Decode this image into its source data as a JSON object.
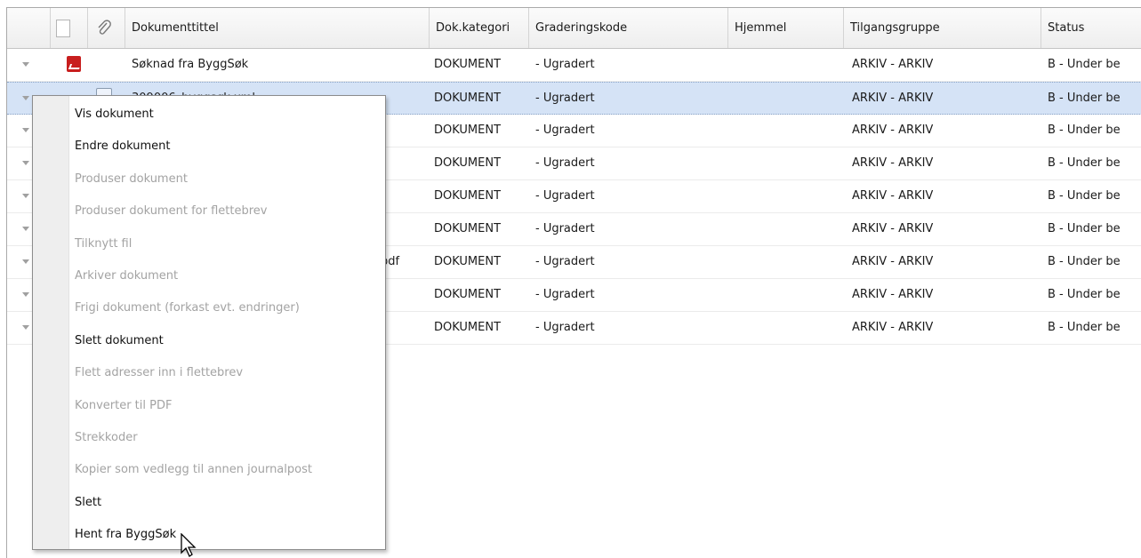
{
  "columns": [
    "Dokumenttittel",
    "Dok.kategori",
    "Graderingskode",
    "Hjemmel",
    "Tilgangsgruppe",
    "Status"
  ],
  "header_icons": [
    "document-icon",
    "paperclip-icon"
  ],
  "rows": [
    {
      "title": "Søknad fra ByggSøk",
      "icon": "pdf-icon",
      "kategori": "DOKUMENT",
      "gradering": "- Ugradert",
      "hjemmel": "",
      "tilgang": "ARKIV - ARKIV",
      "status": "B - Under be"
    },
    {
      "title": "309006_byggsøk.xml",
      "icon": "xml-icon",
      "kategori": "DOKUMENT",
      "gradering": "- Ugradert",
      "hjemmel": "",
      "tilgang": "ARKIV - ARKIV",
      "status": "B - Under be"
    },
    {
      "title": "",
      "icon": "",
      "kategori": "DOKUMENT",
      "gradering": "- Ugradert",
      "hjemmel": "",
      "tilgang": "ARKIV - ARKIV",
      "status": "B - Under be"
    },
    {
      "title": "",
      "icon": "",
      "kategori": "DOKUMENT",
      "gradering": "- Ugradert",
      "hjemmel": "",
      "tilgang": "ARKIV - ARKIV",
      "status": "B - Under be"
    },
    {
      "title": "",
      "icon": "",
      "kategori": "DOKUMENT",
      "gradering": "- Ugradert",
      "hjemmel": "",
      "tilgang": "ARKIV - ARKIV",
      "status": "B - Under be"
    },
    {
      "title": "",
      "icon": "",
      "kategori": "DOKUMENT",
      "gradering": "- Ugradert",
      "hjemmel": "",
      "tilgang": "ARKIV - ARKIV",
      "status": "B - Under be"
    },
    {
      "title": "pdf",
      "icon": "",
      "kategori": "DOKUMENT",
      "gradering": "- Ugradert",
      "hjemmel": "",
      "tilgang": "ARKIV - ARKIV",
      "status": "B - Under be"
    },
    {
      "title": "",
      "icon": "",
      "kategori": "DOKUMENT",
      "gradering": "- Ugradert",
      "hjemmel": "",
      "tilgang": "ARKIV - ARKIV",
      "status": "B - Under be"
    },
    {
      "title": "",
      "icon": "",
      "kategori": "DOKUMENT",
      "gradering": "- Ugradert",
      "hjemmel": "",
      "tilgang": "ARKIV - ARKIV",
      "status": "B - Under be"
    }
  ],
  "context_menu": [
    {
      "label": "Vis dokument",
      "enabled": true
    },
    {
      "label": "Endre dokument",
      "enabled": true
    },
    {
      "label": "Produser dokument",
      "enabled": false
    },
    {
      "label": "Produser dokument for flettebrev",
      "enabled": false
    },
    {
      "label": "Tilknytt fil",
      "enabled": false
    },
    {
      "label": "Arkiver dokument",
      "enabled": false
    },
    {
      "label": "Frigi dokument (forkast evt. endringer)",
      "enabled": false
    },
    {
      "label": "Slett dokument",
      "enabled": true
    },
    {
      "label": "Flett adresser inn i flettebrev",
      "enabled": false
    },
    {
      "label": "Konverter til PDF",
      "enabled": false
    },
    {
      "label": "Strekkoder",
      "enabled": false
    },
    {
      "label": "Kopier som vedlegg til annen journalpost",
      "enabled": false
    },
    {
      "label": "Slett",
      "enabled": true
    },
    {
      "label": "Hent fra ByggSøk",
      "enabled": true
    }
  ],
  "colors": {
    "selected_row": "#d5e3f6",
    "disabled_text": "#a3a3a3",
    "pdf_icon": "#c81e1e"
  }
}
